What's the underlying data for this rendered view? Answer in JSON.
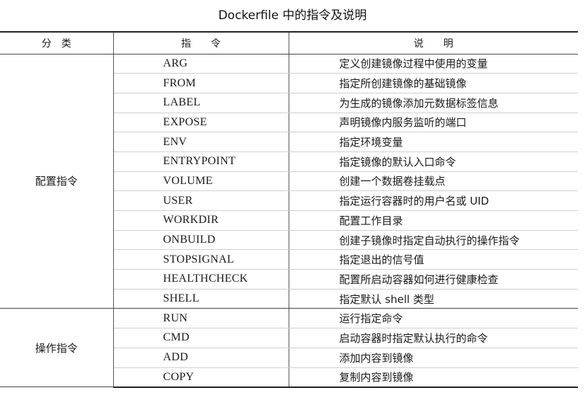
{
  "caption": "Dockerfile 中的指令及说明",
  "headers": {
    "category": "分　类",
    "instruction": "指　　令",
    "description": "说　　明"
  },
  "groups": [
    {
      "category": "配置指令",
      "rows": [
        {
          "instruction": "ARG",
          "description": "定义创建镜像过程中使用的变量"
        },
        {
          "instruction": "FROM",
          "description": "指定所创建镜像的基础镜像"
        },
        {
          "instruction": "LABEL",
          "description": "为生成的镜像添加元数据标签信息"
        },
        {
          "instruction": "EXPOSE",
          "description": "声明镜像内服务监听的端口"
        },
        {
          "instruction": "ENV",
          "description": "指定环境变量"
        },
        {
          "instruction": "ENTRYPOINT",
          "description": "指定镜像的默认入口命令"
        },
        {
          "instruction": "VOLUME",
          "description": "创建一个数据卷挂载点"
        },
        {
          "instruction": "USER",
          "description": "指定运行容器时的用户名或 UID"
        },
        {
          "instruction": "WORKDIR",
          "description": "配置工作目录"
        },
        {
          "instruction": "ONBUILD",
          "description": "创建子镜像时指定自动执行的操作指令"
        },
        {
          "instruction": "STOPSIGNAL",
          "description": "指定退出的信号值"
        },
        {
          "instruction": "HEALTHCHECK",
          "description": "配置所启动容器如何进行健康检查"
        },
        {
          "instruction": "SHELL",
          "description": "指定默认 shell 类型"
        }
      ]
    },
    {
      "category": "操作指令",
      "rows": [
        {
          "instruction": "RUN",
          "description": "运行指定命令"
        },
        {
          "instruction": "CMD",
          "description": "启动容器时指定默认执行的命令"
        },
        {
          "instruction": "ADD",
          "description": "添加内容到镜像"
        },
        {
          "instruction": "COPY",
          "description": "复制内容到镜像"
        }
      ]
    }
  ]
}
